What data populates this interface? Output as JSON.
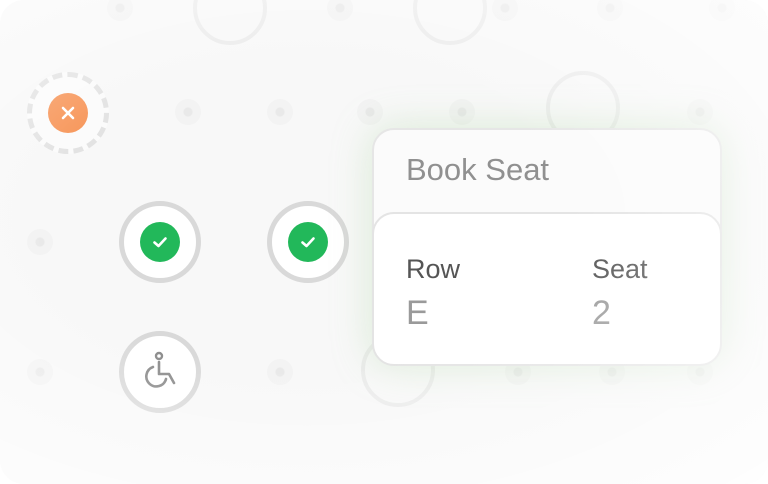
{
  "seat_map": {
    "seats": [
      {
        "status": "unavailable",
        "icon": "close-icon"
      },
      {
        "status": "booked",
        "icon": "check-icon"
      },
      {
        "status": "booked",
        "icon": "check-icon"
      },
      {
        "status": "accessible",
        "icon": "wheelchair-icon"
      }
    ]
  },
  "booking": {
    "title": "Book Seat",
    "row_label": "Row",
    "row_value": "E",
    "seat_label": "Seat",
    "seat_value": "2"
  },
  "colors": {
    "booked": "#22b85a",
    "unavailable": "#f7975b",
    "popover_glow": "#a0d296"
  }
}
